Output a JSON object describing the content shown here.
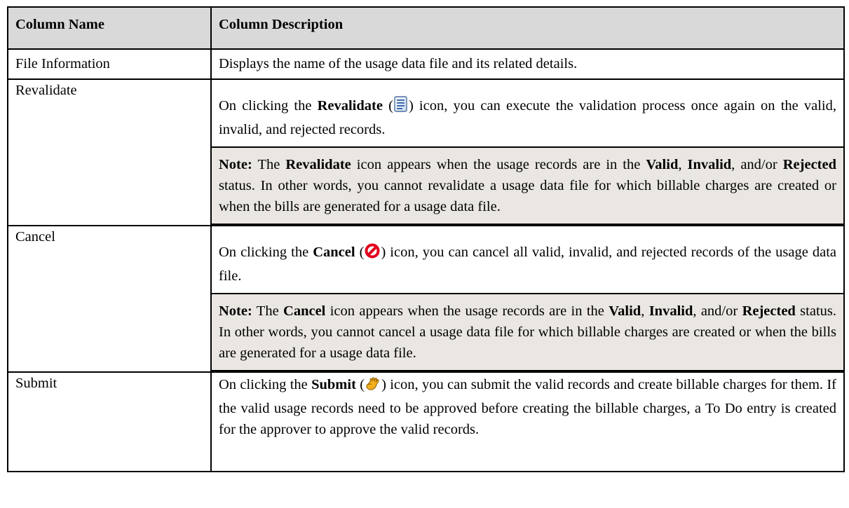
{
  "table": {
    "headers": {
      "name": "Column Name",
      "description": "Column Description"
    },
    "rows": {
      "file": {
        "name": "File Information",
        "description": "Displays the name of the usage data file and its related details."
      },
      "revalidate": {
        "name": "Revalidate",
        "desc_pre": "On clicking the ",
        "desc_bold": "Revalidate",
        "desc_open": " (",
        "desc_post": ") icon, you can execute the validation process once again on the valid, invalid, and rejected records.",
        "icon": "document-list-icon",
        "note": {
          "label": "Note:",
          "t1": " The ",
          "b1": "Revalidate",
          "t2": " icon appears when the usage records are in the ",
          "b2": "Valid",
          "t3": ", ",
          "b3": "Invalid",
          "t4": ", and/or ",
          "b4": "Rejected",
          "t5": " status. In other words, you cannot revalidate a usage data file for which billable charges are created or when the bills are generated for a usage data file."
        }
      },
      "cancel": {
        "name": "Cancel",
        "desc_pre": "On clicking the ",
        "desc_bold": "Cancel",
        "desc_open": " (",
        "desc_post": ") icon, you can cancel all valid, invalid, and rejected records of the usage data file.",
        "icon": "prohibited-icon",
        "note": {
          "label": "Note:",
          "t1": " The ",
          "b1": "Cancel",
          "t2": " icon appears when the usage records are in the ",
          "b2": "Valid",
          "t3": ", ",
          "b3": "Invalid",
          "t4": ", and/or ",
          "b4": "Rejected",
          "t5": " status. In other words, you cannot cancel a usage data file for which billable charges are created or when the bills are generated for a usage data file."
        }
      },
      "submit": {
        "name": "Submit",
        "desc_pre": "On clicking the ",
        "desc_bold": "Submit",
        "desc_open": " (",
        "desc_post": ") icon, you can submit the valid records and create billable charges for them. If the valid usage records need to be approved before creating the billable charges, a To Do entry is created for the approver to approve the valid records.",
        "icon": "hand-pointer-icon"
      }
    }
  },
  "colors": {
    "header_bg": "#d9d9d9",
    "note_bg": "#eae6e1",
    "cancel_icon": "#e0001b"
  }
}
